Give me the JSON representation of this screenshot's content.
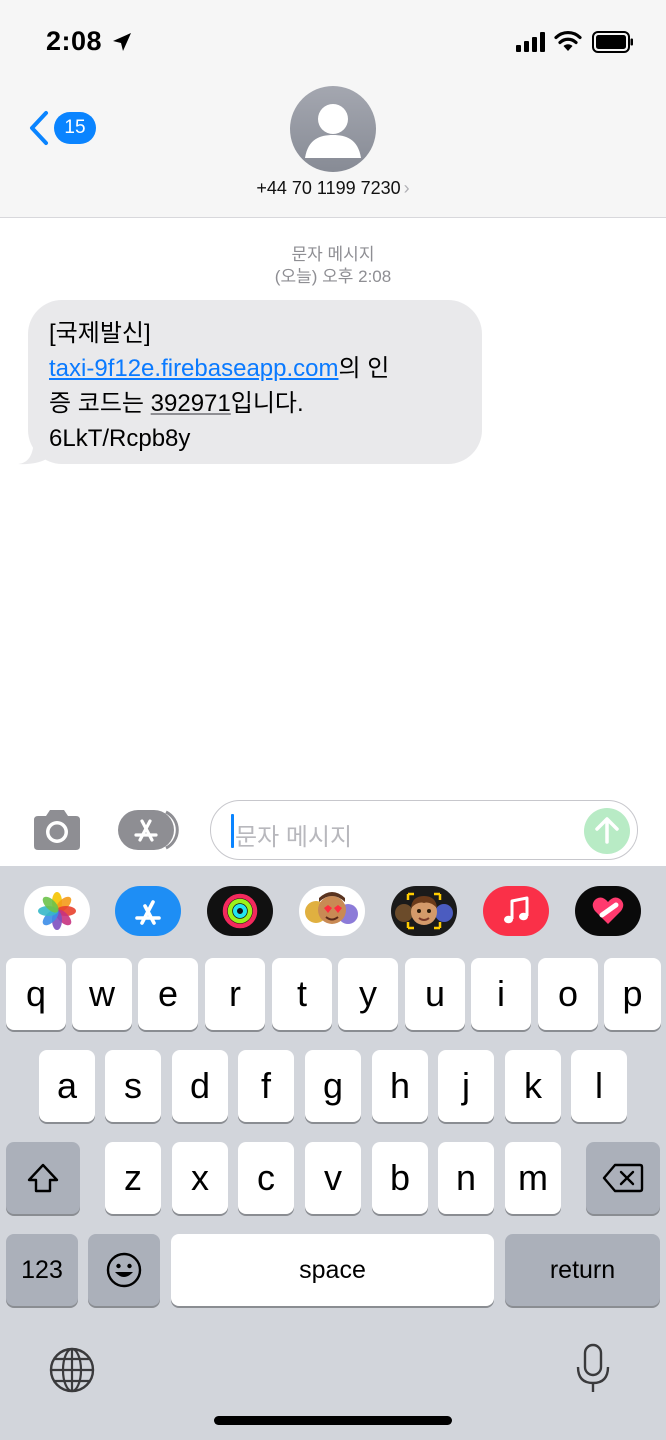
{
  "status_bar": {
    "time": "2:08"
  },
  "nav": {
    "back_count": "15",
    "contact": "+44 70 1199 7230",
    "chevron": "›"
  },
  "thread": {
    "service": "문자 메시지",
    "timestamp": "(오늘) 오후 2:08",
    "message": {
      "line1": "[국제발신]",
      "link": "taxi-9f12e.firebaseapp.com",
      "after_link": "의 인",
      "line3_start": "증 코드는 ",
      "code": "392971",
      "line3_end": "입니다.",
      "line4": "6LkT/Rcpb8y"
    }
  },
  "composer": {
    "placeholder": "문자 메시지"
  },
  "apps": [
    "photos-icon",
    "app-store-icon",
    "activity-icon",
    "memoji-stickers-icon",
    "animoji-icon",
    "music-icon",
    "digital-touch-icon"
  ],
  "keyboard": {
    "row1": [
      "q",
      "w",
      "e",
      "r",
      "t",
      "y",
      "u",
      "i",
      "o",
      "p"
    ],
    "row2": [
      "a",
      "s",
      "d",
      "f",
      "g",
      "h",
      "j",
      "k",
      "l"
    ],
    "row3": [
      "z",
      "x",
      "c",
      "v",
      "b",
      "n",
      "m"
    ],
    "numbers_label": "123",
    "space_label": "space",
    "return_label": "return"
  },
  "colors": {
    "accent": "#0a84ff",
    "link": "#0a7aff",
    "bubble": "#e9e9eb",
    "keyboard_bg": "#d2d5db",
    "send_disabled": "#b8ebc5"
  }
}
